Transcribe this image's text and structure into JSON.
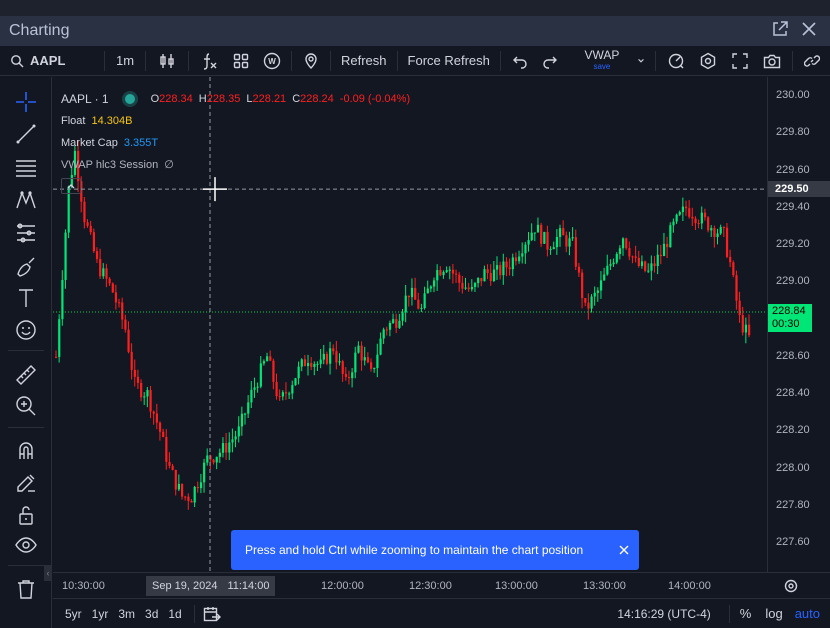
{
  "window": {
    "title": "Charting"
  },
  "toolbar": {
    "symbol": "AAPL",
    "interval": "1m",
    "refresh_label": "Refresh",
    "force_refresh_label": "Force Refresh",
    "vwap_label": "VWAP",
    "vwap_sub": "save"
  },
  "legend": {
    "symbol_interval": "AAPL · 1",
    "o_label": "O",
    "o_value": "228.34",
    "h_label": "H",
    "h_value": "228.35",
    "l_label": "L",
    "l_value": "228.21",
    "c_label": "C",
    "c_value": "228.24",
    "change": "-0.09 (-0.04%)",
    "float_label": "Float",
    "float_value": "14.304B",
    "mcap_label": "Market Cap",
    "mcap_value": "3.355T",
    "vwap_study": "VWAP hlc3 Session",
    "vwap_value": "∅"
  },
  "price_axis": {
    "ticks": [
      "230.00",
      "229.80",
      "229.60",
      "229.40",
      "229.20",
      "229.00",
      "228.80",
      "228.60",
      "228.40",
      "228.20",
      "228.00",
      "227.80",
      "227.60"
    ],
    "crosshair_price": "229.50",
    "last_price": "228.84",
    "countdown": "00:30"
  },
  "time_axis": {
    "ticks": [
      "10:30:00",
      "12:00:00",
      "12:30:00",
      "13:00:00",
      "13:30:00",
      "14:00:00"
    ],
    "crosshair_date": "Sep 19, 2024",
    "crosshair_time": "11:14:00"
  },
  "bottom": {
    "ranges": [
      "5yr",
      "1yr",
      "3m",
      "3d",
      "1d"
    ],
    "clock": "14:16:29 (UTC-4)",
    "percent_label": "%",
    "log_label": "log",
    "auto_label": "auto"
  },
  "toast": {
    "message": "Press and hold Ctrl while zooming to maintain the chart position"
  },
  "chart_data": {
    "type": "candlestick",
    "symbol": "AAPL",
    "date": "Sep 19, 2024",
    "ylim": [
      227.5,
      230.05
    ],
    "up_color": "#00e676",
    "down_color": "#ff1f1f",
    "vwap_color": "#00ff55",
    "close_path": [
      [
        0,
        228.6
      ],
      [
        4,
        229.5
      ],
      [
        6,
        229.7
      ],
      [
        9,
        229.35
      ],
      [
        13,
        229.1
      ],
      [
        18,
        228.95
      ],
      [
        22,
        228.75
      ],
      [
        25,
        228.45
      ],
      [
        29,
        228.4
      ],
      [
        33,
        228.2
      ],
      [
        36,
        228.0
      ],
      [
        40,
        227.85
      ],
      [
        43,
        227.85
      ],
      [
        48,
        228.05
      ],
      [
        53,
        228.1
      ],
      [
        58,
        228.2
      ],
      [
        62,
        228.4
      ],
      [
        67,
        228.6
      ],
      [
        71,
        228.35
      ],
      [
        76,
        228.5
      ],
      [
        80,
        228.6
      ],
      [
        84,
        228.55
      ],
      [
        88,
        228.65
      ],
      [
        92,
        228.45
      ],
      [
        96,
        228.65
      ],
      [
        100,
        228.5
      ],
      [
        104,
        228.75
      ],
      [
        108,
        228.8
      ],
      [
        112,
        228.95
      ],
      [
        116,
        228.85
      ],
      [
        120,
        229.05
      ],
      [
        124,
        229.1
      ],
      [
        128,
        229.0
      ],
      [
        132,
        228.95
      ],
      [
        136,
        229.05
      ],
      [
        140,
        229.05
      ],
      [
        144,
        229.1
      ],
      [
        148,
        229.2
      ],
      [
        152,
        229.3
      ],
      [
        156,
        229.2
      ],
      [
        160,
        229.25
      ],
      [
        164,
        229.2
      ],
      [
        168,
        228.85
      ],
      [
        172,
        228.95
      ],
      [
        176,
        229.1
      ],
      [
        180,
        229.25
      ],
      [
        184,
        229.1
      ],
      [
        188,
        229.05
      ],
      [
        192,
        229.15
      ],
      [
        196,
        229.3
      ],
      [
        200,
        229.4
      ],
      [
        204,
        229.35
      ],
      [
        208,
        229.3
      ],
      [
        212,
        229.25
      ],
      [
        214,
        229.1
      ],
      [
        217,
        228.8
      ],
      [
        220,
        228.7
      ]
    ]
  }
}
